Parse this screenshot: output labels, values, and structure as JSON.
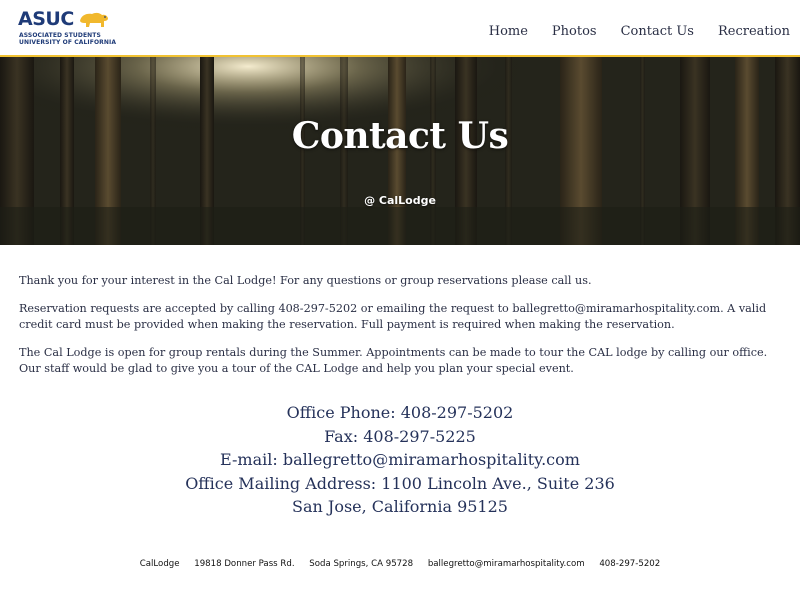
{
  "logo": {
    "word": "ASUC",
    "line1": "ASSOCIATED STUDENTS",
    "line2": "UNIVERSITY OF CALIFORNIA",
    "bear_icon": "bear-icon"
  },
  "nav": {
    "items": [
      {
        "label": "Home"
      },
      {
        "label": "Photos"
      },
      {
        "label": "Contact Us"
      },
      {
        "label": "Recreation"
      }
    ]
  },
  "hero": {
    "title": "Contact Us",
    "subtitle": "@ CalLodge"
  },
  "content": {
    "paragraphs": [
      "Thank you for your interest in the Cal Lodge! For any questions or group reservations please call us.",
      "Reservation requests are accepted by calling 408-297-5202 or emailing the request to ballegretto@miramarhospitality.com. A valid credit card must be provided when making the reservation. Full payment is required when making the reservation.",
      "The Cal Lodge is open for group rentals during the Summer. Appointments can be made to tour the CAL lodge by calling our office. Our staff would be glad to give you a tour of the CAL Lodge and help you plan your special event."
    ],
    "contact_lines": [
      "Office Phone: 408-297-5202",
      "Fax: 408-297-5225",
      "E-mail: ballegretto@miramarhospitality.com",
      "Office Mailing Address: 1100 Lincoln Ave., Suite 236",
      "San Jose, California 95125"
    ]
  },
  "footer": {
    "name": "CalLodge",
    "street": "19818 Donner Pass Rd.",
    "city": "Soda Springs, CA 95728",
    "email": "ballegretto@miramarhospitality.com",
    "phone": "408-297-5202"
  }
}
